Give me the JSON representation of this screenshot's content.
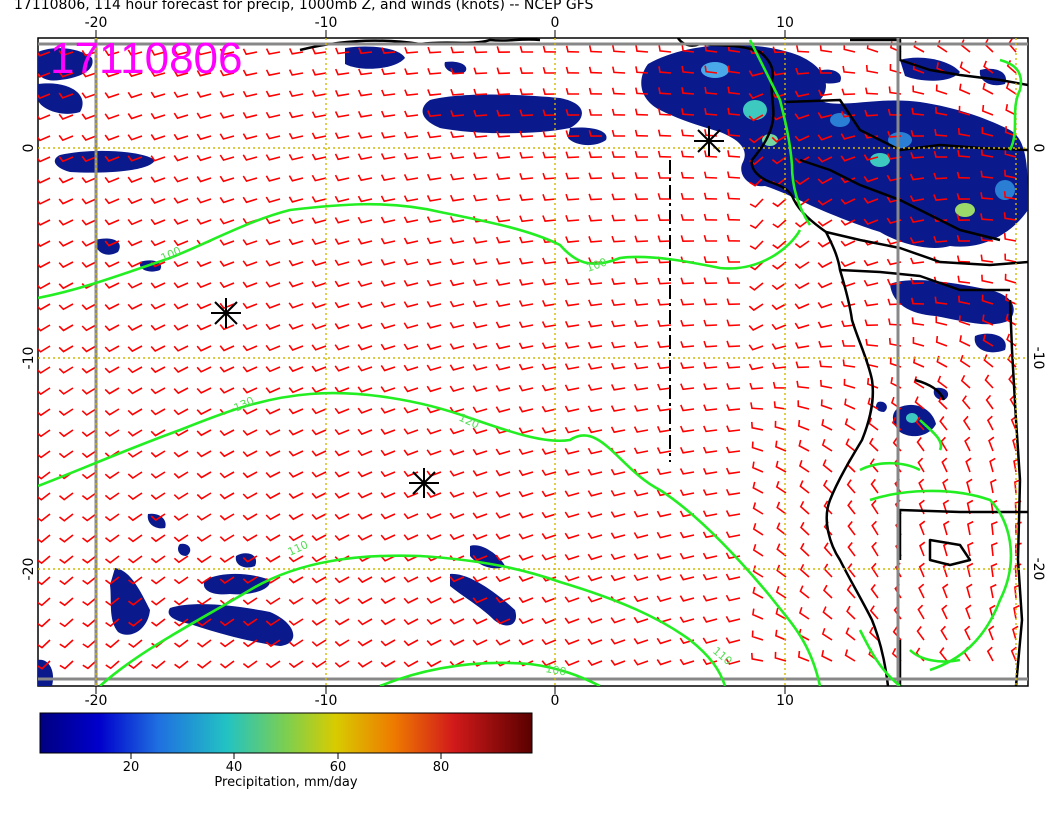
{
  "title": "17110806, 114 hour forecast for precip, 1000mb Z, and winds (knots) -- NCEP GFS",
  "stamp": "17110806",
  "axes": {
    "x_ticks": [
      -20,
      -10,
      0,
      10
    ],
    "y_ticks": [
      0,
      -10,
      -20
    ],
    "lon_range": [
      -23.2,
      20
    ],
    "lat_range": [
      -25.2,
      5
    ]
  },
  "contours": [
    {
      "value": 100,
      "label": "100"
    },
    {
      "value": 110,
      "label": "110"
    },
    {
      "value": 120,
      "label": "120"
    },
    {
      "value": 130,
      "label": "130"
    }
  ],
  "colorbar": {
    "ticks": [
      "20",
      "40",
      "60",
      "80"
    ],
    "title": "Precipitation, mm/day",
    "range": [
      0,
      100
    ]
  },
  "colors": {
    "wind": "#ff0000",
    "contour": "#22ee22",
    "grid": "#ccbb00",
    "stamp": "#ff00ff"
  },
  "markers": [
    {
      "lon": -14.5,
      "lat": -7.8
    },
    {
      "lon": -5.7,
      "lat": -16.0
    },
    {
      "lon": 6.7,
      "lat": 0.3
    }
  ]
}
